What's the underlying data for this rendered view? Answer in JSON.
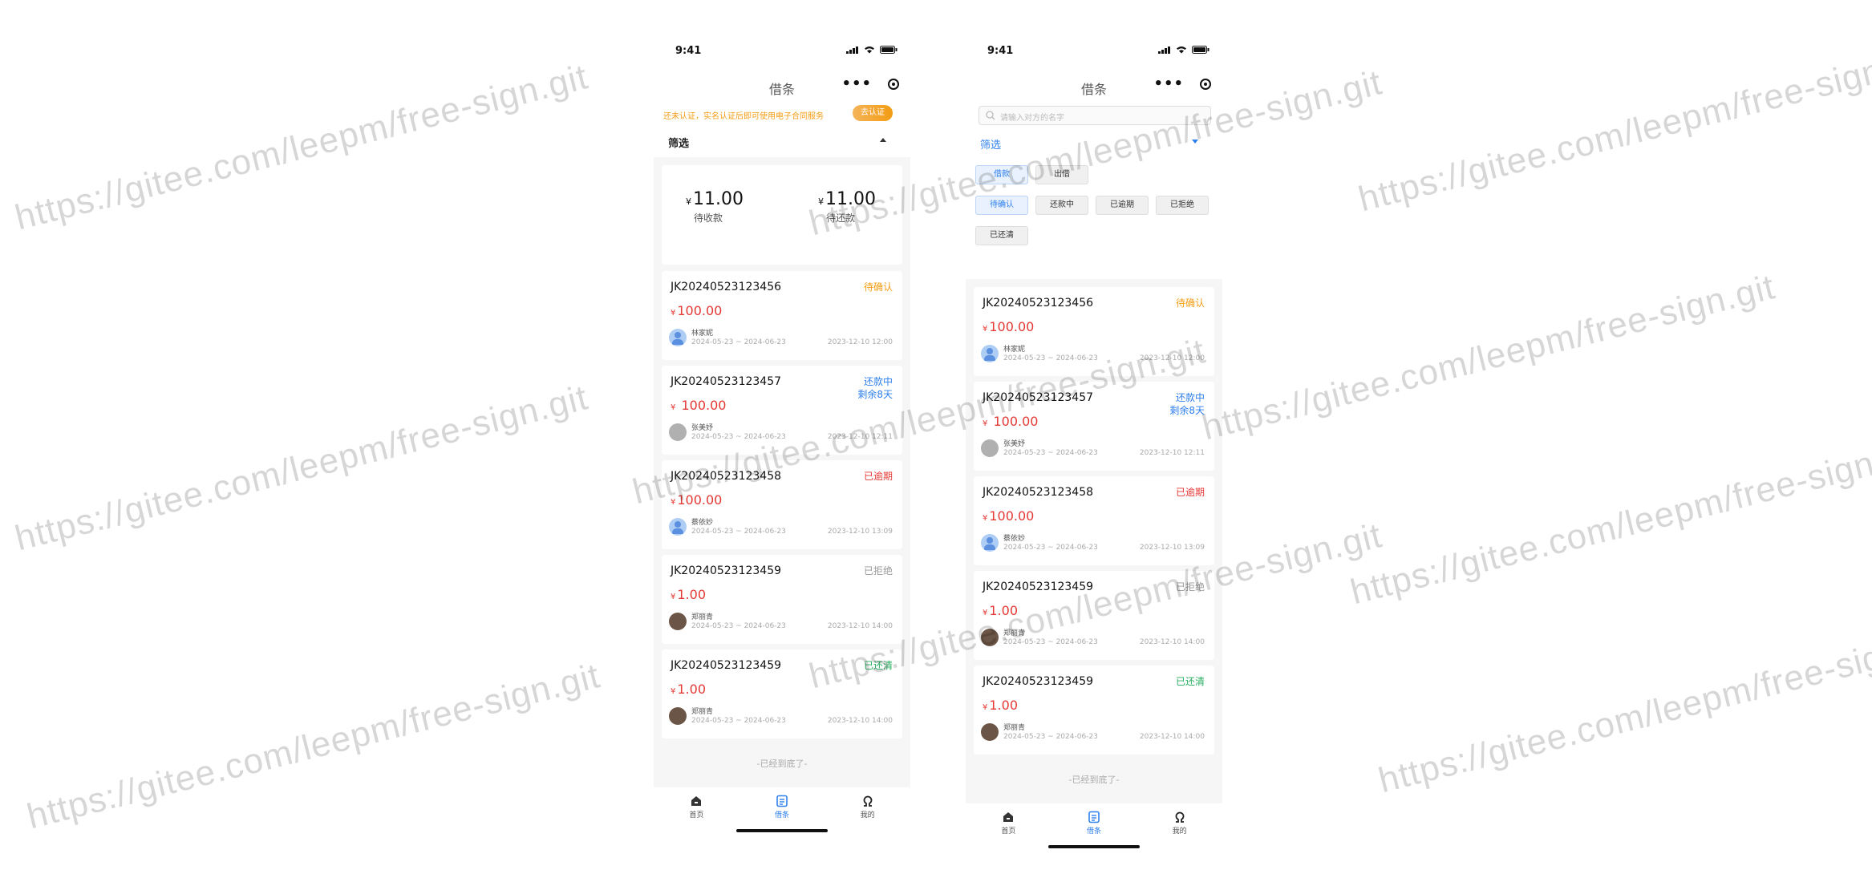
{
  "status_time": "9:41",
  "nav_title": "借条",
  "notice": {
    "text": "还未认证，实名认证后即可使用电子合同服务",
    "button": "去认证"
  },
  "filter_label": "筛选",
  "summary": {
    "currency": "¥",
    "receivable_amount": "11.00",
    "receivable_label": "待收款",
    "payable_amount": "11.00",
    "payable_label": "待还款"
  },
  "cards": [
    {
      "no": "JK20240523123456",
      "status": "待确认",
      "status_color": "#f39c12",
      "currency": "¥",
      "amount": "100.00",
      "name": "林家妮",
      "range": "2024-05-23 ~ 2024-06-23",
      "time": "2023-12-10 12:00",
      "avatar": "blue"
    },
    {
      "no": "JK20240523123457",
      "status": "还款中",
      "status_sub": "剩余8天",
      "status_color": "#2f80ed",
      "currency": "¥",
      "amount": " 100.00",
      "name": "张美妤",
      "range": "2024-05-23 ~ 2024-06-23",
      "time": "2023-12-10 12:11",
      "avatar": "gray"
    },
    {
      "no": "JK20240523123458",
      "status": "已逾期",
      "status_color": "#e53935",
      "currency": "¥",
      "amount": "100.00",
      "name": "蔡依妙",
      "range": "2024-05-23 ~ 2024-06-23",
      "time": "2023-12-10 13:09",
      "avatar": "blue"
    },
    {
      "no": "JK20240523123459",
      "status": "已拒绝",
      "status_color": "#999999",
      "currency": "¥",
      "amount": "1.00",
      "name": "郑丽青",
      "range": "2024-05-23 ~ 2024-06-23",
      "time": "2023-12-10 14:00",
      "avatar": "dark"
    },
    {
      "no": "JK20240523123459",
      "status": "已还清",
      "status_color": "#27ae60",
      "currency": "¥",
      "amount": "1.00",
      "name": "郑丽青",
      "range": "2024-05-23 ~ 2024-06-23",
      "time": "2023-12-10 14:00",
      "avatar": "dark"
    }
  ],
  "end_text": "-已经到底了-",
  "tabs": [
    {
      "label": "首页",
      "icon": "home-icon"
    },
    {
      "label": "借条",
      "icon": "note-icon"
    },
    {
      "label": "我的",
      "icon": "profile-icon"
    }
  ],
  "search_placeholder": "请输入对方的名字",
  "type_chips": [
    "借款",
    "出借"
  ],
  "status_chips": [
    "待确认",
    "还款中",
    "已逾期",
    "已拒绝",
    "已还清"
  ],
  "watermark_text": "https://gitee.com/leepm/free-sign.git",
  "colors": {
    "accent": "#2f80ed",
    "amount": "#e53935",
    "warning": "#f39c12"
  }
}
